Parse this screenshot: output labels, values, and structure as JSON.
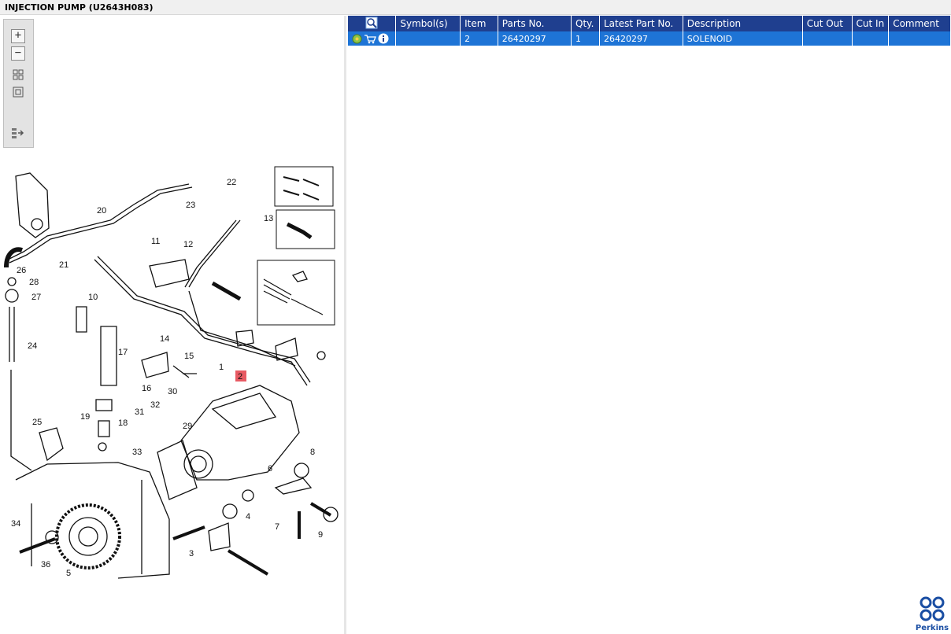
{
  "window": {
    "title": "INJECTION PUMP (U2643H083)"
  },
  "toolbar": {
    "zoom_in": "+",
    "zoom_out": "−"
  },
  "diagram": {
    "highlighted_callout": "2",
    "callouts": [
      "1",
      "2",
      "3",
      "4",
      "5",
      "6",
      "7",
      "8",
      "9",
      "10",
      "11",
      "12",
      "13",
      "14",
      "15",
      "16",
      "17",
      "18",
      "19",
      "20",
      "21",
      "22",
      "23",
      "24",
      "25",
      "26",
      "27",
      "28",
      "29",
      "30",
      "31",
      "32",
      "33",
      "34",
      "36"
    ],
    "highlight_color": "#e85a63"
  },
  "parts_table": {
    "columns": [
      "",
      "Symbol(s)",
      "Item",
      "Parts No.",
      "Qty.",
      "Latest Part No.",
      "Description",
      "Cut Out",
      "Cut In",
      "Comment"
    ],
    "rows": [
      {
        "symbols": "",
        "item": "2",
        "part_no": "26420297",
        "qty": "1",
        "latest_part_no": "26420297",
        "description": "SOLENOID",
        "cut_out": "",
        "cut_in": "",
        "comment": ""
      }
    ]
  },
  "brand": {
    "name": "Perkins",
    "color": "#1a4ea3"
  },
  "colors": {
    "header": "#1f3f8f",
    "selected_row": "#1e74d6"
  }
}
